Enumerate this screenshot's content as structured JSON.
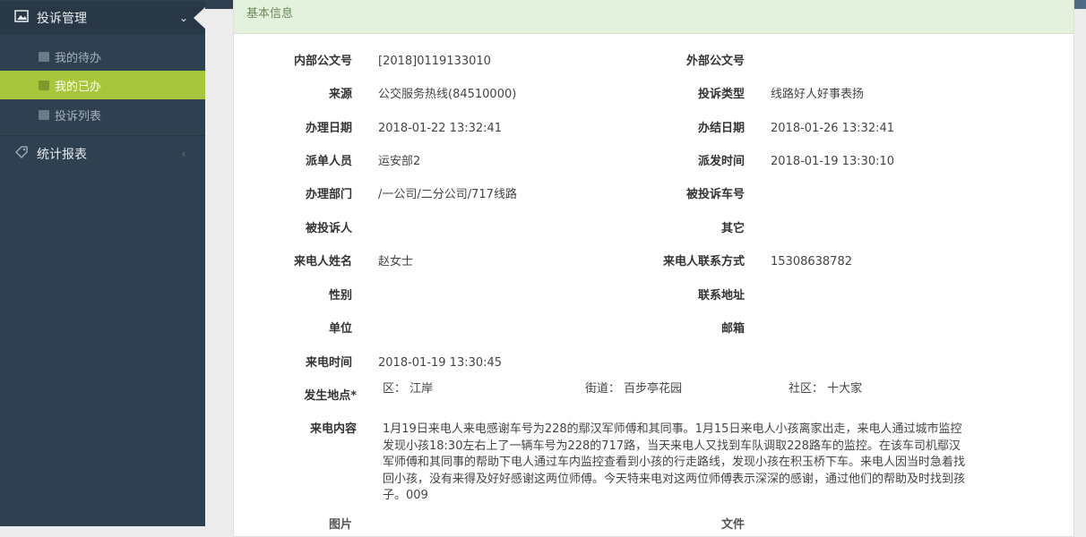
{
  "sidebar": {
    "groups": [
      {
        "label": "投诉管理",
        "arrow": "⌄"
      },
      {
        "label": "统计报表",
        "arrow": "‹"
      }
    ],
    "items": [
      {
        "label": "我的待办"
      },
      {
        "label": "我的已办"
      },
      {
        "label": "投诉列表"
      }
    ]
  },
  "panel": {
    "heading": "基本信息"
  },
  "fields": {
    "internal_no": {
      "label": "内部公文号",
      "value": "[2018]0119133010"
    },
    "external_no": {
      "label": "外部公文号",
      "value": ""
    },
    "source": {
      "label": "来源",
      "value": "公交服务热线(84510000)"
    },
    "complaint_type": {
      "label": "投诉类型",
      "value": "线路好人好事表扬"
    },
    "handle_date": {
      "label": "办理日期",
      "value": "2018-01-22 13:32:41"
    },
    "close_date": {
      "label": "办结日期",
      "value": "2018-01-26 13:32:41"
    },
    "dispatcher": {
      "label": "派单人员",
      "value": "运安部2"
    },
    "dispatch_time": {
      "label": "派发时间",
      "value": "2018-01-19 13:30:10"
    },
    "handle_dept": {
      "label": "办理部门",
      "value": "/一公司/二分公司/717线路"
    },
    "vehicle_no": {
      "label": "被投诉车号",
      "value": ""
    },
    "complainee": {
      "label": "被投诉人",
      "value": ""
    },
    "other": {
      "label": "其它",
      "value": ""
    },
    "caller_name": {
      "label": "来电人姓名",
      "value": "赵女士"
    },
    "caller_phone": {
      "label": "来电人联系方式",
      "value": "15308638782"
    },
    "gender": {
      "label": "性别",
      "value": ""
    },
    "address": {
      "label": "联系地址",
      "value": ""
    },
    "unit": {
      "label": "单位",
      "value": ""
    },
    "email": {
      "label": "邮箱",
      "value": ""
    },
    "call_time": {
      "label": "来电时间",
      "value": "2018-01-19 13:30:45"
    },
    "location": {
      "label": "发生地点*",
      "district": "区：  江岸",
      "street": "街道：  百步亭花园",
      "community": "社区：  十大家"
    },
    "call_content": {
      "label": "来电内容",
      "value": "1月19日来电人来电感谢车号为228的鄢汉军师傅和其同事。1月15日来电人小孩离家出走，来电人通过城市监控发现小孩18:30左右上了一辆车号为228的717路，当天来电人又找到车队调取228路车的监控。在该车司机鄢汉军师傅和其同事的帮助下电人通过车内监控查看到小孩的行走路线，发现小孩在积玉桥下车。来电人因当时急着找回小孩，没有来得及好好感谢这两位师傅。今天特来电对这两位师傅表示深深的感谢，通过他们的帮助及时找到孩子。009"
    },
    "pictures": {
      "label": "图片"
    },
    "files": {
      "label": "文件"
    }
  }
}
